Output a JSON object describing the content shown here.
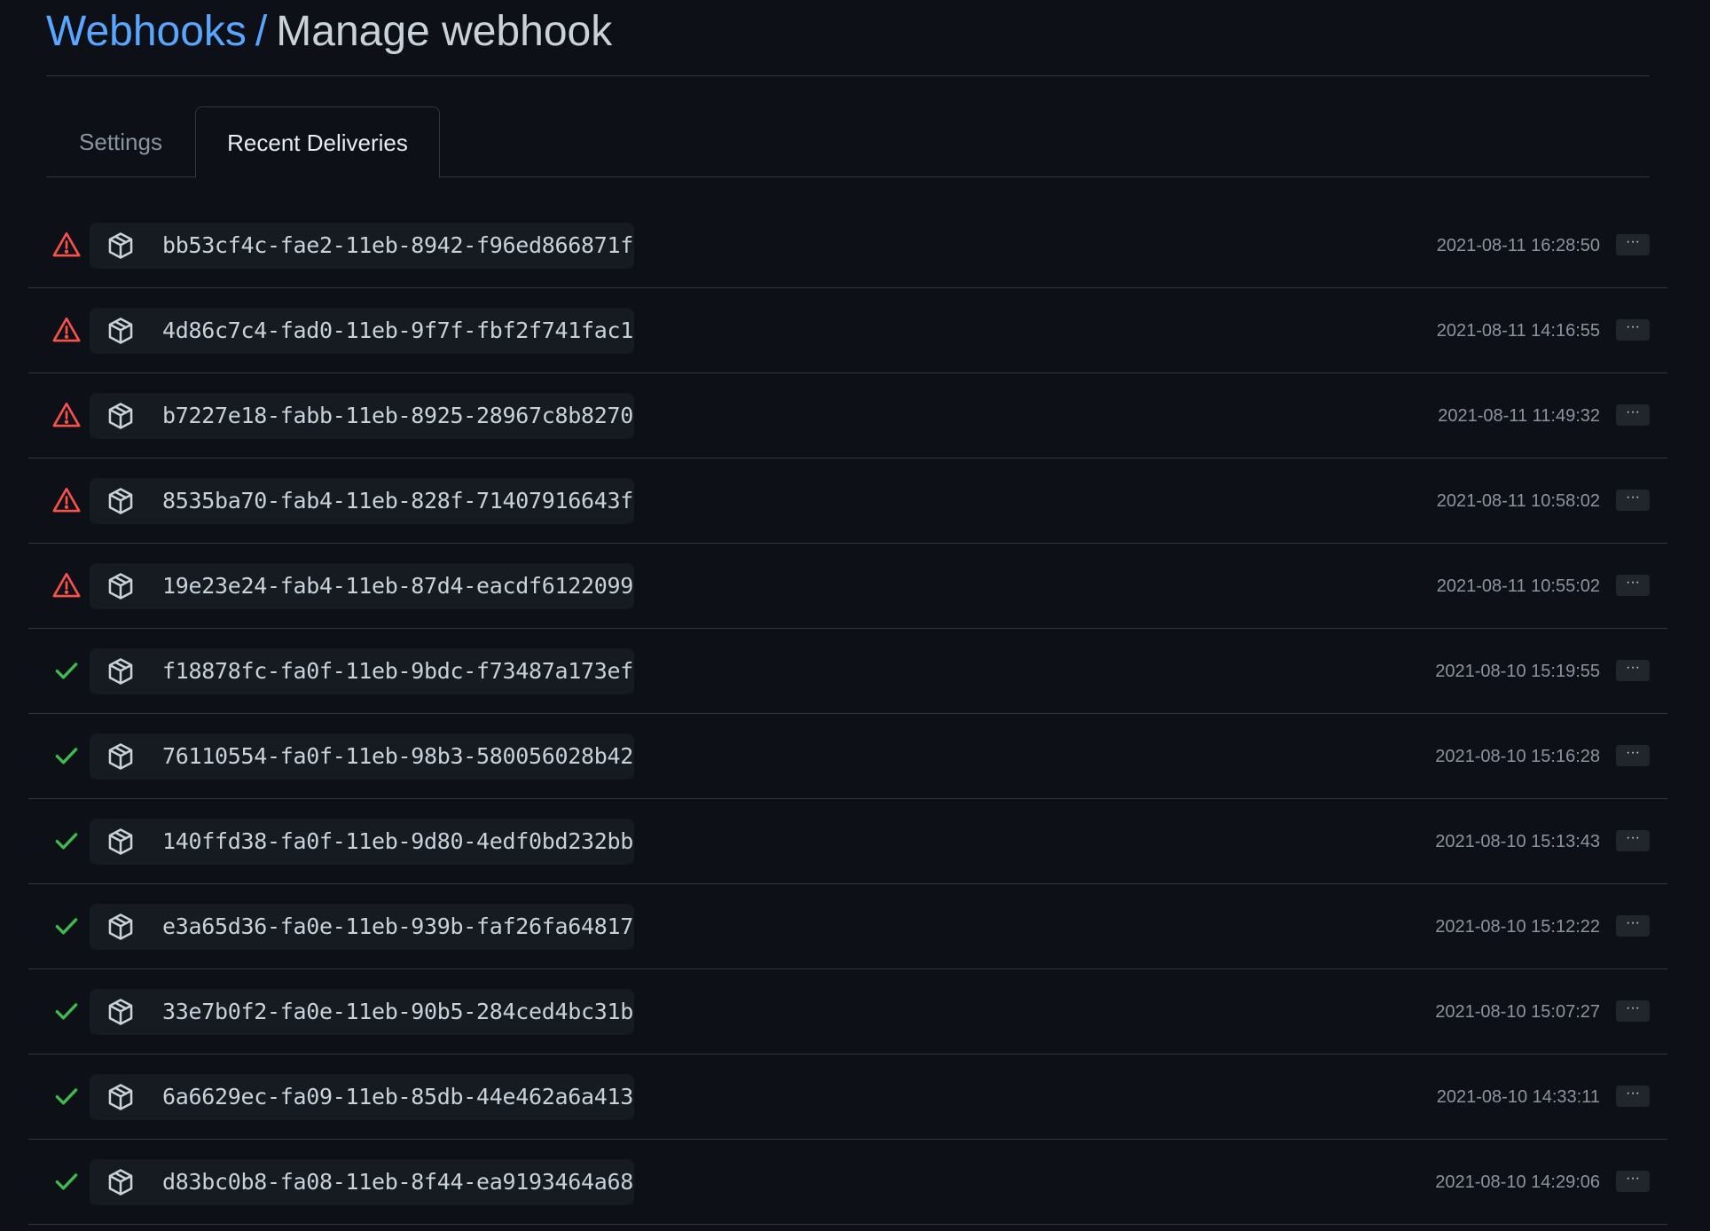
{
  "header": {
    "breadcrumb_label": "Webhooks",
    "separator": "/",
    "title": "Manage webhook"
  },
  "tabs": [
    {
      "label": "Settings",
      "active": false
    },
    {
      "label": "Recent Deliveries",
      "active": true
    }
  ],
  "colors": {
    "error": "#f85149",
    "success": "#3fb950",
    "link": "#58a6ff"
  },
  "deliveries": [
    {
      "status": "error",
      "status_icon": "alert-icon",
      "guid": "bb53cf4c-fae2-11eb-8942-f96ed866871f",
      "timestamp": "2021-08-11 16:28:50"
    },
    {
      "status": "error",
      "status_icon": "alert-icon",
      "guid": "4d86c7c4-fad0-11eb-9f7f-fbf2f741fac1",
      "timestamp": "2021-08-11 14:16:55"
    },
    {
      "status": "error",
      "status_icon": "alert-icon",
      "guid": "b7227e18-fabb-11eb-8925-28967c8b8270",
      "timestamp": "2021-08-11 11:49:32"
    },
    {
      "status": "error",
      "status_icon": "alert-icon",
      "guid": "8535ba70-fab4-11eb-828f-71407916643f",
      "timestamp": "2021-08-11 10:58:02"
    },
    {
      "status": "error",
      "status_icon": "alert-icon",
      "guid": "19e23e24-fab4-11eb-87d4-eacdf6122099",
      "timestamp": "2021-08-11 10:55:02"
    },
    {
      "status": "success",
      "status_icon": "check-icon",
      "guid": "f18878fc-fa0f-11eb-9bdc-f73487a173ef",
      "timestamp": "2021-08-10 15:19:55"
    },
    {
      "status": "success",
      "status_icon": "check-icon",
      "guid": "76110554-fa0f-11eb-98b3-580056028b42",
      "timestamp": "2021-08-10 15:16:28"
    },
    {
      "status": "success",
      "status_icon": "check-icon",
      "guid": "140ffd38-fa0f-11eb-9d80-4edf0bd232bb",
      "timestamp": "2021-08-10 15:13:43"
    },
    {
      "status": "success",
      "status_icon": "check-icon",
      "guid": "e3a65d36-fa0e-11eb-939b-faf26fa64817",
      "timestamp": "2021-08-10 15:12:22"
    },
    {
      "status": "success",
      "status_icon": "check-icon",
      "guid": "33e7b0f2-fa0e-11eb-90b5-284ced4bc31b",
      "timestamp": "2021-08-10 15:07:27"
    },
    {
      "status": "success",
      "status_icon": "check-icon",
      "guid": "6a6629ec-fa09-11eb-85db-44e462a6a413",
      "timestamp": "2021-08-10 14:33:11"
    },
    {
      "status": "success",
      "status_icon": "check-icon",
      "guid": "d83bc0b8-fa08-11eb-8f44-ea9193464a68",
      "timestamp": "2021-08-10 14:29:06"
    }
  ],
  "row_actions": {
    "more_label": "···",
    "more_icon": "kebab-horizontal-icon",
    "package_icon": "package-icon"
  }
}
